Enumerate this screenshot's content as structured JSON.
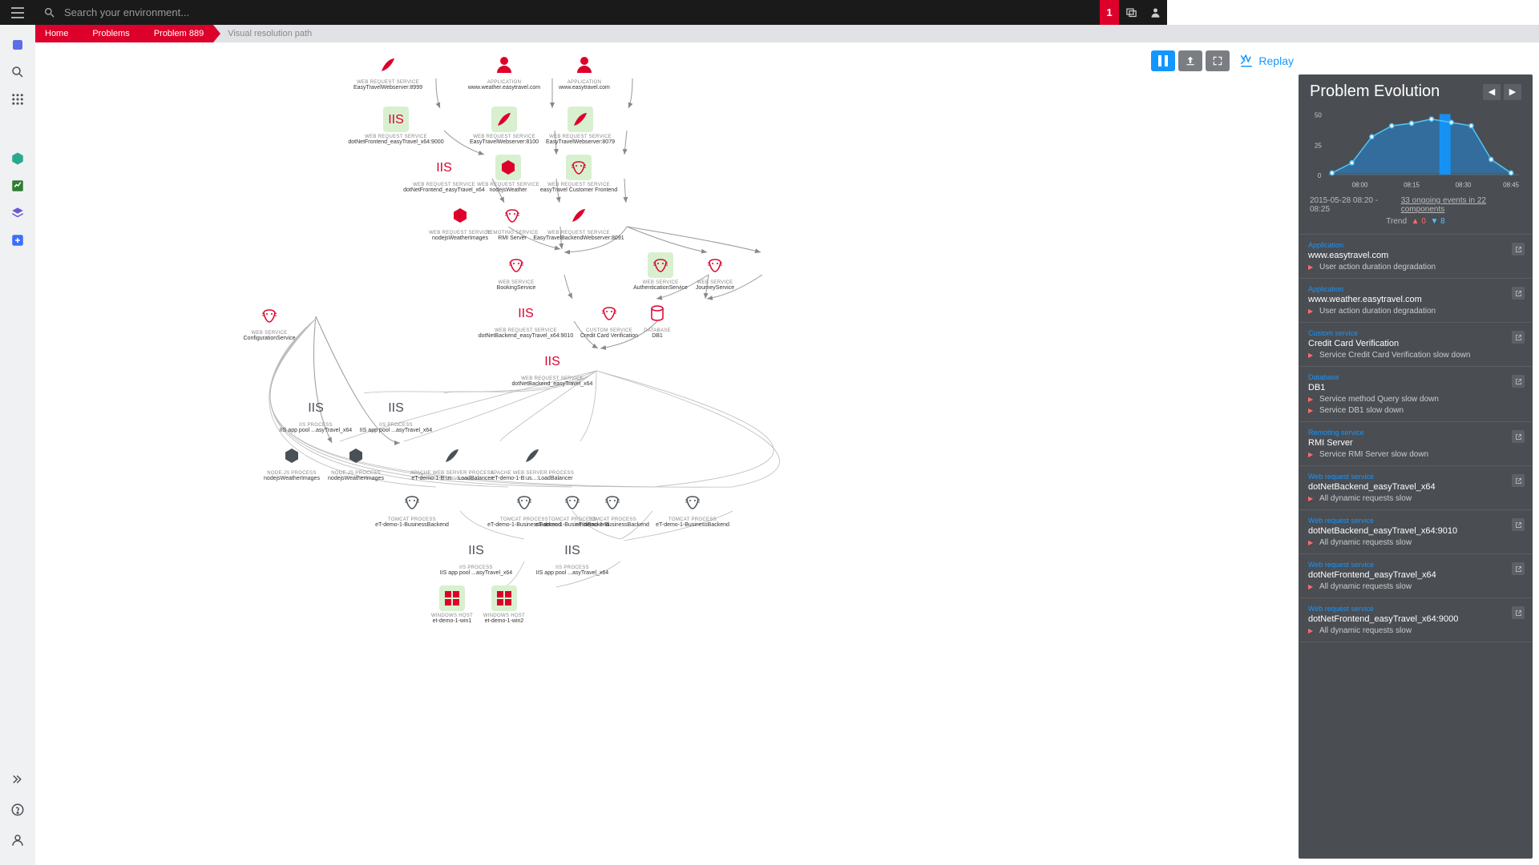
{
  "header": {
    "search_placeholder": "Search your environment...",
    "badge": "1"
  },
  "breadcrumb": [
    "Home",
    "Problems",
    "Problem 889",
    "Visual resolution path"
  ],
  "controls": {
    "replay": "Replay"
  },
  "panel": {
    "title": "Problem Evolution",
    "time_range": "2015-05-28 08:20 - 08:25",
    "ongoing": "33 ongoing events in 22 components",
    "trend_label": "Trend",
    "trend_up": "0",
    "trend_down": "8",
    "items": [
      {
        "cat": "Application",
        "name": "www.easytravel.com",
        "events": [
          "User action duration degradation"
        ]
      },
      {
        "cat": "Application",
        "name": "www.weather.easytravel.com",
        "events": [
          "User action duration degradation"
        ]
      },
      {
        "cat": "Custom service",
        "name": "Credit Card Verification",
        "events": [
          "Service Credit Card Verification slow down"
        ]
      },
      {
        "cat": "Database",
        "name": "DB1",
        "events": [
          "Service method Query slow down",
          "Service DB1 slow down"
        ]
      },
      {
        "cat": "Remoting service",
        "name": "RMI Server",
        "events": [
          "Service RMI Server slow down"
        ]
      },
      {
        "cat": "Web request service",
        "name": "dotNetBackend_easyTravel_x64",
        "events": [
          "All dynamic requests slow"
        ]
      },
      {
        "cat": "Web request service",
        "name": "dotNetBackend_easyTravel_x64:9010",
        "events": [
          "All dynamic requests slow"
        ]
      },
      {
        "cat": "Web request service",
        "name": "dotNetFrontend_easyTravel_x64",
        "events": [
          "All dynamic requests slow"
        ]
      },
      {
        "cat": "Web request service",
        "name": "dotNetFrontend_easyTravel_x64:9000",
        "events": [
          "All dynamic requests slow"
        ]
      }
    ]
  },
  "chart_data": {
    "type": "line",
    "ylabel": "",
    "ylim": [
      0,
      50
    ],
    "yticks": [
      0,
      25,
      50
    ],
    "xticks": [
      "08:00",
      "08:15",
      "08:30",
      "08:45"
    ],
    "x": [
      0,
      1,
      2,
      3,
      4,
      5,
      6,
      7,
      8,
      9
    ],
    "values": [
      3,
      10,
      28,
      36,
      38,
      42,
      38,
      35,
      12,
      3
    ],
    "highlight_x": 5
  },
  "nodes": {
    "r1": [
      {
        "type": "WEB REQUEST SERVICE",
        "name": "EasyTravelWebserver:8999",
        "ic": "feather"
      },
      {
        "type": "APPLICATION",
        "name": "www.weather.easytravel.com",
        "ic": "user"
      },
      {
        "type": "APPLICATION",
        "name": "www.easytravel.com",
        "ic": "user"
      }
    ],
    "r2": [
      {
        "type": "WEB REQUEST SERVICE",
        "name": "dotNetFrontend_easyTravel_x64:9000",
        "ic": "iis",
        "g": true
      },
      {
        "type": "WEB REQUEST SERVICE",
        "name": "EasyTravelWebserver:8100",
        "ic": "feather",
        "g": true
      },
      {
        "type": "WEB REQUEST SERVICE",
        "name": "EasyTravelWebserver:8079",
        "ic": "feather",
        "g": true
      }
    ],
    "r3": [
      {
        "type": "WEB REQUEST SERVICE",
        "name": "dotNetFrontend_easyTravel_x64",
        "ic": "iis"
      },
      {
        "type": "WEB REQUEST SERVICE",
        "name": "nodejsWeather",
        "ic": "node",
        "g": true
      },
      {
        "type": "WEB REQUEST SERVICE",
        "name": "easyTravel Customer Frontend",
        "ic": "tomcat",
        "g": true
      }
    ],
    "r4": [
      {
        "type": "WEB REQUEST SERVICE",
        "name": "nodejsWeatherImages",
        "ic": "node"
      },
      {
        "type": "REMOTING SERVICE",
        "name": "RMI Server",
        "ic": "tomcat"
      },
      {
        "type": "WEB REQUEST SERVICE",
        "name": "EasyTravelBackendWebserver:8091",
        "ic": "feather"
      }
    ],
    "r4b": [
      {
        "type": "WEB SERVICE",
        "name": "ConfigurationService",
        "ic": "tomcat"
      }
    ],
    "r5": [
      {
        "type": "WEB SERVICE",
        "name": "BookingService",
        "ic": "tomcat"
      },
      {
        "type": "WEB SERVICE",
        "name": "AuthenticationService",
        "ic": "tomcat",
        "g": true
      },
      {
        "type": "WEB SERVICE",
        "name": "JourneyService",
        "ic": "tomcat"
      }
    ],
    "r6": [
      {
        "type": "WEB REQUEST SERVICE",
        "name": "dotNetBackend_easyTravel_x64:9010",
        "ic": "iis"
      },
      {
        "type": "CUSTOM SERVICE",
        "name": "Credit Card Verification",
        "ic": "tomcat"
      },
      {
        "type": "DATABASE",
        "name": "DB1",
        "ic": "db"
      }
    ],
    "r7": [
      {
        "type": "WEB REQUEST SERVICE",
        "name": "dotNetBackend_easyTravel_x64",
        "ic": "iis"
      }
    ],
    "r8": [
      {
        "type": "IIS PROCESS",
        "name": "IIS app pool ...asyTravel_x64",
        "ic": "iisk"
      },
      {
        "type": "IIS PROCESS",
        "name": "IIS app pool ...asyTravel_x64",
        "ic": "iisk"
      }
    ],
    "r9": [
      {
        "type": "NODE.JS PROCESS",
        "name": "nodejsWeatherImages",
        "ic": "nodek"
      },
      {
        "type": "NODE.JS PROCESS",
        "name": "nodejsWeatherImages",
        "ic": "nodek"
      },
      {
        "type": "APACHE WEB SERVER PROCESS",
        "name": "eT-demo-1-B:us...:LoadBalancer",
        "ic": "featherk"
      },
      {
        "type": "APACHE WEB SERVER PROCESS",
        "name": "eT-demo-1-B:us...:LoadBalancer",
        "ic": "featherk"
      }
    ],
    "r10": [
      {
        "type": "TOMCAT PROCESS",
        "name": "eT-demo-1-BusinessBackend",
        "ic": "tomcatk"
      },
      {
        "type": "TOMCAT PROCESS",
        "name": "eT-demo-1-BusinessBackend",
        "ic": "tomcatk"
      },
      {
        "type": "TOMCAT PROCESS",
        "name": "eT-demo-1-BusinessBackend",
        "ic": "tomcatk"
      },
      {
        "type": "TOMCAT PROCESS",
        "name": "eT-demo-1-BusinessBackend",
        "ic": "tomcatk"
      },
      {
        "type": "TOMCAT PROCESS",
        "name": "eT-demo-1-BusinessBackend",
        "ic": "tomcatk"
      }
    ],
    "r11": [
      {
        "type": "IIS PROCESS",
        "name": "IIS app pool ...asyTravel_x64",
        "ic": "iisk"
      },
      {
        "type": "IIS PROCESS",
        "name": "IIS app pool ...asyTravel_x64",
        "ic": "iisk"
      }
    ],
    "r12": [
      {
        "type": "WINDOWS HOST",
        "name": "et-demo-1-win1",
        "ic": "win",
        "g": true
      },
      {
        "type": "WINDOWS HOST",
        "name": "et-demo-1-win2",
        "ic": "win",
        "g": true
      }
    ]
  }
}
